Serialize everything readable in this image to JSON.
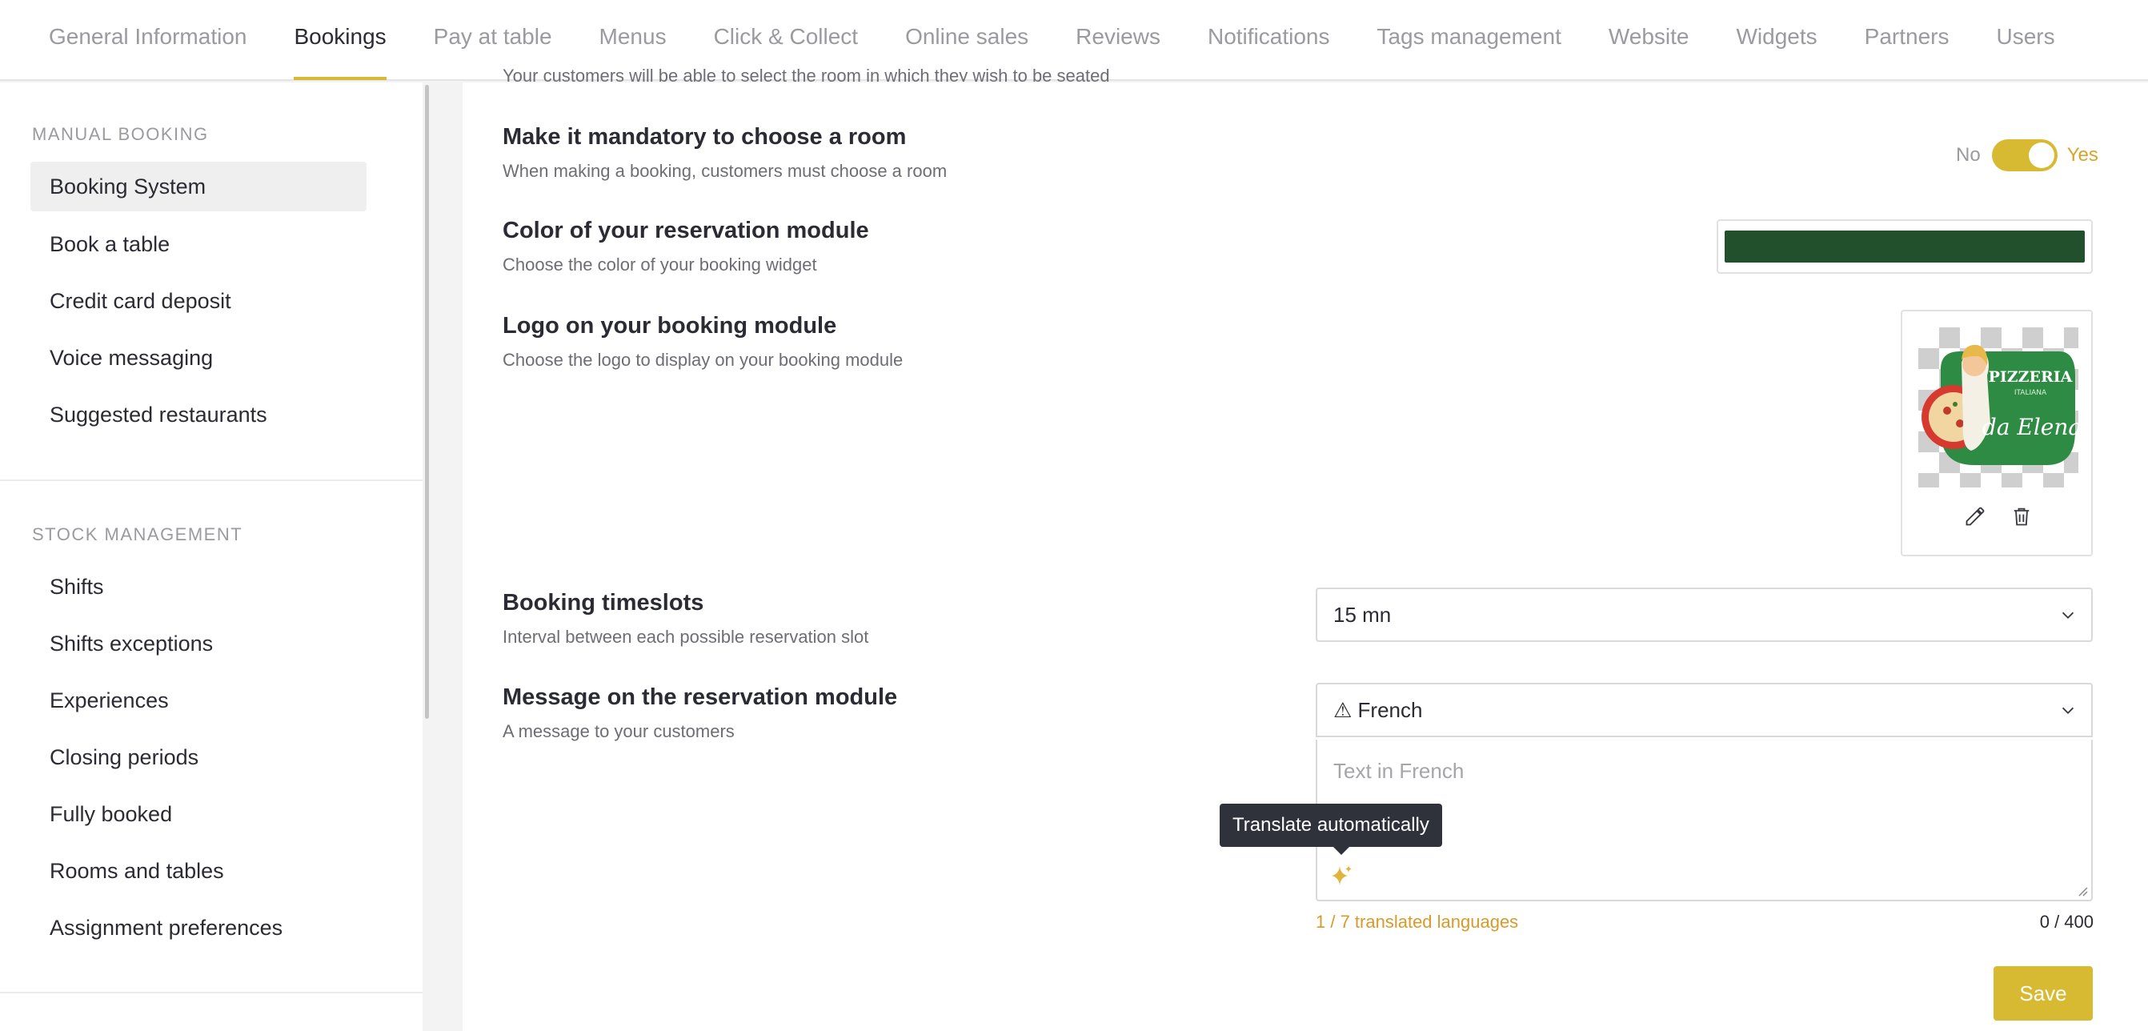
{
  "nav": {
    "tabs": [
      {
        "label": "General Information"
      },
      {
        "label": "Bookings"
      },
      {
        "label": "Pay at table"
      },
      {
        "label": "Menus"
      },
      {
        "label": "Click & Collect"
      },
      {
        "label": "Online sales"
      },
      {
        "label": "Reviews"
      },
      {
        "label": "Notifications"
      },
      {
        "label": "Tags management"
      },
      {
        "label": "Website"
      },
      {
        "label": "Widgets"
      },
      {
        "label": "Partners"
      },
      {
        "label": "Users"
      }
    ],
    "active_tab": "Bookings"
  },
  "sidebar": {
    "manual_booking": {
      "title": "MANUAL BOOKING",
      "items": [
        {
          "label": "Booking System"
        },
        {
          "label": "Book a table"
        },
        {
          "label": "Credit card deposit"
        },
        {
          "label": "Voice messaging"
        },
        {
          "label": "Suggested restaurants"
        }
      ]
    },
    "stock_management": {
      "title": "STOCK MANAGEMENT",
      "items": [
        {
          "label": "Shifts"
        },
        {
          "label": "Shifts exceptions"
        },
        {
          "label": "Experiences"
        },
        {
          "label": "Closing periods"
        },
        {
          "label": "Fully booked"
        },
        {
          "label": "Rooms and tables"
        },
        {
          "label": "Assignment preferences"
        }
      ]
    },
    "active_item": "Booking System"
  },
  "main": {
    "cutoff_text": "Your customers will be able to select the room in which they wish to be seated",
    "mandatory_room": {
      "title": "Make it mandatory to choose a room",
      "description": "When making a booking, customers must choose a room",
      "toggle_no": "No",
      "toggle_yes": "Yes",
      "toggle_on": true
    },
    "color_module": {
      "title": "Color of your reservation module",
      "description": "Choose the color of your booking widget",
      "color": "#22502c"
    },
    "logo_module": {
      "title": "Logo on your booking module",
      "description": "Choose the logo to display on your booking module",
      "logo_text_1": "PIZZERIA",
      "logo_text_2": "ITALIANA",
      "logo_text_3": "da Elena"
    },
    "timeslots": {
      "title": "Booking timeslots",
      "description": "Interval between each possible reservation slot",
      "selected": "15 mn"
    },
    "message_module": {
      "title": "Message on the reservation module",
      "description": "A message to your customers",
      "language_selected": "⚠ French",
      "textarea_placeholder": "Text in French",
      "tooltip": "Translate automatically",
      "translated_count": "1 / 7 translated languages",
      "char_counter": "0 / 400"
    },
    "save_label": "Save"
  },
  "colors": {
    "accent": "#d8b932",
    "text_dark": "#2b2b33",
    "text_muted": "#6d6d73",
    "link_orange": "#d89a2a"
  }
}
